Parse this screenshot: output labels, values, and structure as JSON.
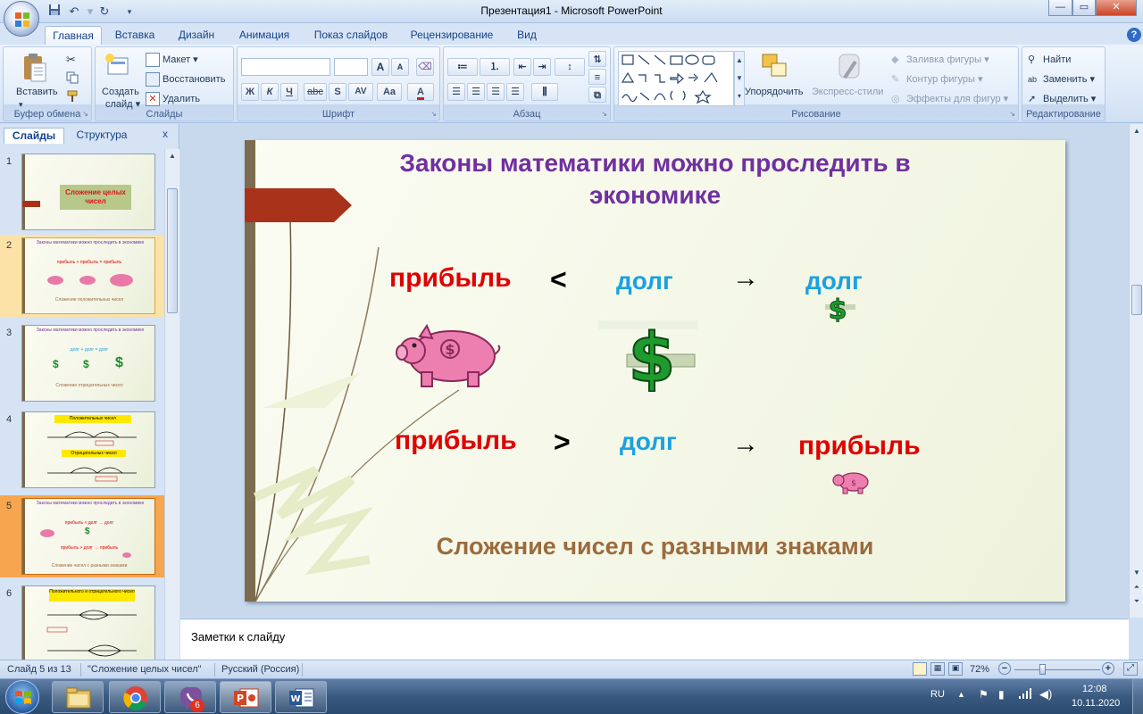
{
  "window": {
    "title": "Презентация1 - Microsoft PowerPoint",
    "controls": {
      "minimize": "—",
      "maximize": "▭",
      "close": "✕"
    },
    "help": "?"
  },
  "quick_access": {
    "save_icon": "save-icon",
    "undo_icon": "undo-icon",
    "redo_icon": "redo-icon",
    "customize": "▾"
  },
  "tabs": [
    "Главная",
    "Вставка",
    "Дизайн",
    "Анимация",
    "Показ слайдов",
    "Рецензирование",
    "Вид"
  ],
  "active_tab": "Главная",
  "ribbon": {
    "clipboard": {
      "label": "Буфер обмена",
      "paste": "Вставить"
    },
    "slides": {
      "label": "Слайды",
      "new_slide_line1": "Создать",
      "new_slide_line2": "слайд ▾",
      "layout": "Макет ▾",
      "reset": "Восстановить",
      "delete": "Удалить"
    },
    "font": {
      "label": "Шрифт",
      "font_name": "",
      "font_size": "",
      "grow": "A",
      "shrink": "A",
      "bold": "Ж",
      "italic": "К",
      "underline": "Ч",
      "strike": "abc",
      "shadow": "S",
      "spacing": "AV",
      "case": "Aa"
    },
    "paragraph": {
      "label": "Абзац"
    },
    "drawing": {
      "label": "Рисование",
      "arrange": "Упорядочить",
      "quick_styles": "Экспресс-стили",
      "fill": "Заливка фигуры",
      "outline": "Контур фигуры",
      "effects": "Эффекты для фигур"
    },
    "editing": {
      "label": "Редактирование",
      "find": "Найти",
      "replace": "Заменить",
      "select": "Выделить"
    }
  },
  "panel": {
    "tabs": [
      "Слайды",
      "Структура"
    ],
    "close": "x",
    "thumbnails": [
      {
        "num": "1",
        "title": "Сложение целых чисел"
      },
      {
        "num": "2",
        "title": "Законы математики можно проследить в экономике",
        "row": "прибыль + прибыль = прибыль",
        "caption": "Сложение положительных чисел"
      },
      {
        "num": "3",
        "title": "Законы математики можно проследить в экономике",
        "row": "долг + долг = долг",
        "caption": "Сложение отрицательных чисел"
      },
      {
        "num": "4",
        "title": "Положительных чисел",
        "title2": "Отрицательных чисел"
      },
      {
        "num": "5",
        "title": "Законы математики можно проследить в экономике",
        "row1": "прибыль < долг → долг",
        "row2": "прибыль > долг → прибыль",
        "caption": "Сложение чисел с разными знаками"
      },
      {
        "num": "6",
        "title": "Положительного и отрицательного чисел"
      }
    ]
  },
  "slide": {
    "title": "Законы математики можно проследить в экономике",
    "row1": {
      "left": "прибыль",
      "op": "<",
      "middle": "долг",
      "arrow": "→",
      "result": "долг"
    },
    "row2": {
      "left": "прибыль",
      "op": ">",
      "middle": "долг",
      "arrow": "→",
      "result": "прибыль"
    },
    "caption": "Сложение чисел с разными знаками",
    "colors": {
      "title": "#7030a0",
      "profit": "#e00000",
      "debt": "#1ba1e2",
      "caption": "#9b6b3d",
      "arrow": "#000000"
    }
  },
  "notes_placeholder": "Заметки к слайду",
  "status": {
    "slide_info": "Слайд 5 из 13",
    "theme": "\"Сложение целых чисел\"",
    "language": "Русский (Россия)",
    "zoom": "72%"
  },
  "taskbar": {
    "apps": [
      "start",
      "file-explorer",
      "chrome",
      "viber",
      "powerpoint",
      "word"
    ],
    "viber_badge": "6",
    "lang": "RU",
    "time": "12:08",
    "date": "10.11.2020"
  }
}
